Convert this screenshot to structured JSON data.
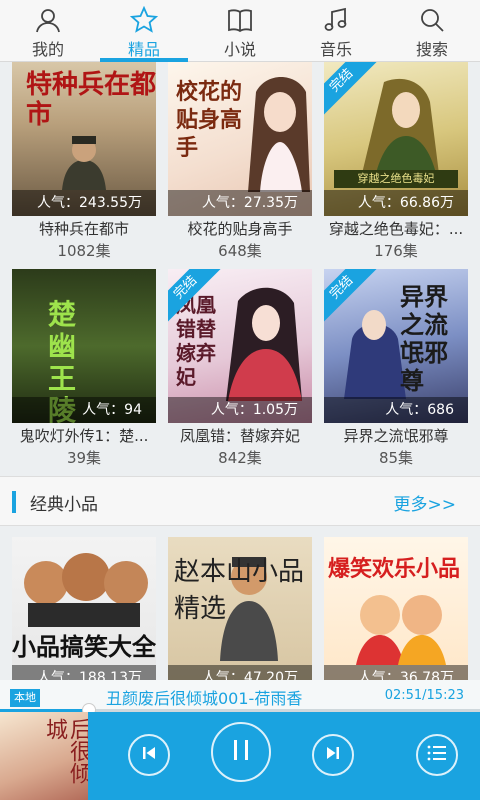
{
  "nav": {
    "items": [
      {
        "label": "我的",
        "icon": "user-icon"
      },
      {
        "label": "精品",
        "icon": "star-icon"
      },
      {
        "label": "小说",
        "icon": "book-icon"
      },
      {
        "label": "音乐",
        "icon": "music-note-icon"
      },
      {
        "label": "搜索",
        "icon": "search-icon"
      }
    ],
    "active_index": 1,
    "accent": "#1aa3e0"
  },
  "grid": {
    "rows": [
      [
        {
          "title": "特种兵在都市",
          "popularity": "人气：243.55万",
          "episodes": "1082集",
          "cover_text": "特种兵在都市",
          "complete": false
        },
        {
          "title": "校花的贴身高手",
          "popularity": "人气：27.35万",
          "episodes": "648集",
          "cover_text": "校花的贴身高手",
          "complete": false
        },
        {
          "title": "穿越之绝色毒妃：...",
          "popularity": "人气：66.86万",
          "episodes": "176集",
          "cover_text": "穿越之绝色毒妃",
          "complete": true,
          "ribbon": "完结"
        }
      ],
      [
        {
          "title": "鬼吹灯外传1：楚...",
          "popularity": "人气：94",
          "episodes": "39集",
          "cover_text": "楚幽王陵",
          "complete": false
        },
        {
          "title": "凤凰错：替嫁弃妃",
          "popularity": "人气：1.05万",
          "episodes": "842集",
          "cover_text": "凤凰错替嫁弃妃",
          "complete": true,
          "ribbon": "完结"
        },
        {
          "title": "异界之流氓邪尊",
          "popularity": "人气：686",
          "episodes": "85集",
          "cover_text": "异界之流氓邪尊",
          "complete": true,
          "ribbon": "完结"
        }
      ],
      [
        {
          "popularity": "人气：188.13万",
          "cover_text": "小品搞笑大全"
        },
        {
          "popularity": "人气：47.20万",
          "cover_text": "赵本山小品精选"
        },
        {
          "popularity": "人气：36.78万",
          "cover_text": "爆笑欢乐小品"
        }
      ]
    ]
  },
  "section": {
    "title": "经典小品",
    "more": "更多>>"
  },
  "player": {
    "tag": "本地",
    "song": "丑颜废后很倾城001-荷雨香",
    "time": "02:51/15:23",
    "progress": 0.185,
    "cover_text": "丑颜废后很倾城"
  }
}
